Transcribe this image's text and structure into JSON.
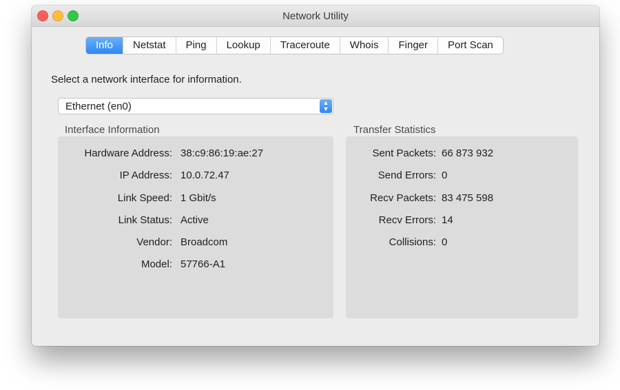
{
  "window": {
    "title": "Network Utility"
  },
  "tabs": [
    {
      "label": "Info",
      "active": true
    },
    {
      "label": "Netstat",
      "active": false
    },
    {
      "label": "Ping",
      "active": false
    },
    {
      "label": "Lookup",
      "active": false
    },
    {
      "label": "Traceroute",
      "active": false
    },
    {
      "label": "Whois",
      "active": false
    },
    {
      "label": "Finger",
      "active": false
    },
    {
      "label": "Port Scan",
      "active": false
    }
  ],
  "info": {
    "instruction": "Select a network interface for information.",
    "interface_select": "Ethernet (en0)",
    "interface_section": {
      "title": "Interface Information",
      "rows": [
        {
          "label": "Hardware Address:",
          "value": "38:c9:86:19:ae:27"
        },
        {
          "label": "IP Address:",
          "value": "10.0.72.47"
        },
        {
          "label": "Link Speed:",
          "value": "1 Gbit/s"
        },
        {
          "label": "Link Status:",
          "value": "Active"
        },
        {
          "label": "Vendor:",
          "value": "Broadcom"
        },
        {
          "label": "Model:",
          "value": "57766-A1"
        }
      ]
    },
    "transfer_section": {
      "title": "Transfer Statistics",
      "rows": [
        {
          "label": "Sent Packets:",
          "value": "66 873 932"
        },
        {
          "label": "Send Errors:",
          "value": "0"
        },
        {
          "label": "Recv Packets:",
          "value": "83 475 598"
        },
        {
          "label": "Recv Errors:",
          "value": "14"
        },
        {
          "label": "Collisions:",
          "value": "0"
        }
      ]
    }
  },
  "colors": {
    "accent": "#2e86f3",
    "close": "#fc605c",
    "minimize": "#fdbc40",
    "zoom": "#34c84a"
  },
  "icons": {
    "select_arrows": "chevron-up-down-icon"
  }
}
